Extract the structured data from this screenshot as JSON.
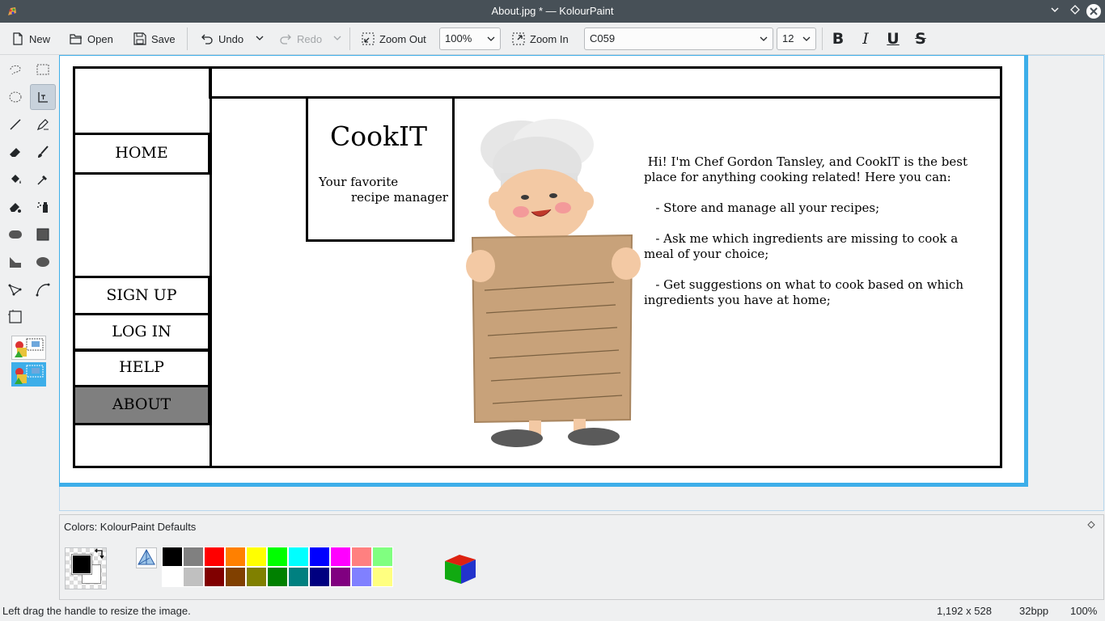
{
  "window": {
    "title": "About.jpg * — KolourPaint"
  },
  "toolbar": {
    "new_label": "New",
    "open_label": "Open",
    "save_label": "Save",
    "undo_label": "Undo",
    "redo_label": "Redo",
    "zoom_out_label": "Zoom Out",
    "zoom_value": "100%",
    "zoom_in_label": "Zoom In",
    "font_family": "C059",
    "font_size": "12",
    "bold_label": "B",
    "italic_label": "I",
    "underline_label": "U",
    "strike_label": "S"
  },
  "tools": [
    {
      "name": "free-form-selection-icon"
    },
    {
      "name": "rectangular-selection-icon"
    },
    {
      "name": "elliptical-selection-icon"
    },
    {
      "name": "text-tool-icon",
      "active": true
    },
    {
      "name": "line-tool-icon"
    },
    {
      "name": "pen-tool-icon"
    },
    {
      "name": "eraser-tool-icon"
    },
    {
      "name": "brush-tool-icon"
    },
    {
      "name": "flood-fill-icon"
    },
    {
      "name": "color-picker-icon"
    },
    {
      "name": "color-eraser-icon"
    },
    {
      "name": "spraycan-icon"
    },
    {
      "name": "rounded-rectangle-icon"
    },
    {
      "name": "rectangle-icon"
    },
    {
      "name": "polygon-icon"
    },
    {
      "name": "ellipse-icon"
    },
    {
      "name": "connected-lines-icon"
    },
    {
      "name": "curve-icon"
    },
    {
      "name": "zoom-icon"
    }
  ],
  "image": {
    "nav": {
      "home": "HOME",
      "sign_up": "SIGN UP",
      "log_in": "LOG IN",
      "help": "HELP",
      "about": "ABOUT"
    },
    "logo_title": "CookIT",
    "tagline_line1": "Your favorite",
    "tagline_line2": "recipe manager",
    "intro_lines": [
      " Hi! I'm Chef Gordon Tansley, and CookIT is the best",
      "place for anything cooking related! Here you can:",
      "",
      "   - Store and manage all your recipes;",
      "",
      "   - Ask me which ingredients are missing to cook a",
      "meal of your choice;",
      "",
      "   - Get suggestions on what to cook based on which",
      "ingredients you have at home;"
    ]
  },
  "palette": {
    "title": "Colors: KolourPaint Defaults",
    "top_row": [
      "#000000",
      "#808080",
      "#ff0000",
      "#ff8000",
      "#ffff00",
      "#00ff00",
      "#00ffff",
      "#0000ff",
      "#ff00ff",
      "#ff8080",
      "#80ff80"
    ],
    "bottom_row": [
      "#ffffff",
      "#c0c0c0",
      "#800000",
      "#804000",
      "#808000",
      "#008000",
      "#008080",
      "#000080",
      "#800080",
      "#8080ff",
      "#ffff80"
    ],
    "foreground": "#000000",
    "background": "#ffffff"
  },
  "status": {
    "message": "Left drag the handle to resize the image.",
    "dimensions": "1,192 x 528",
    "depth": "32bpp",
    "zoom": "100%"
  }
}
